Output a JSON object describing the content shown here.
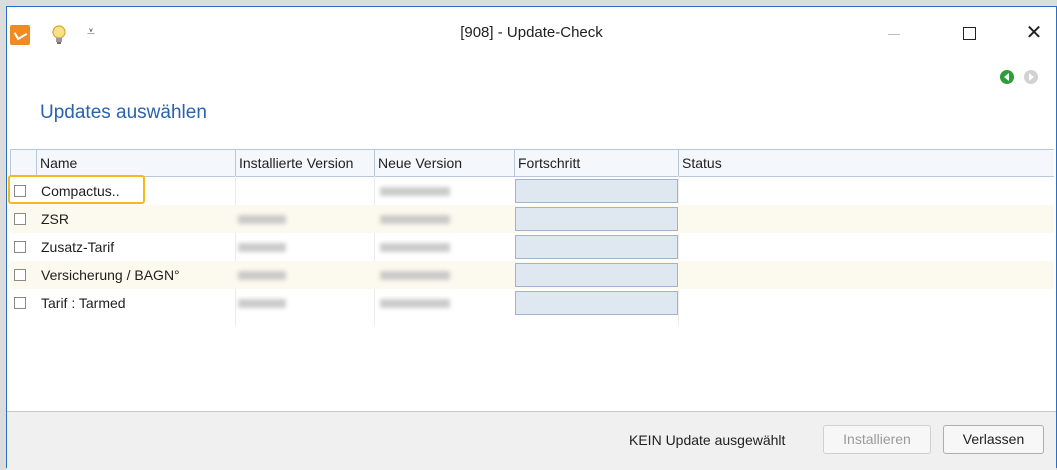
{
  "window": {
    "title": "[908] - Update-Check",
    "quick_access": "⩡",
    "close_glyph": "✕"
  },
  "heading": "Updates auswählen",
  "columns": [
    "Name",
    "Installierte Version",
    "Neue Version",
    "Fortschritt",
    "Status"
  ],
  "rows": [
    {
      "name": "Compactus..",
      "installed_blurred": false,
      "new_blurred": true,
      "checked": false,
      "highlighted": true
    },
    {
      "name": "ZSR",
      "installed_blurred": true,
      "new_blurred": true,
      "checked": false
    },
    {
      "name": "Zusatz-Tarif",
      "installed_blurred": true,
      "new_blurred": true,
      "checked": false
    },
    {
      "name": "Versicherung / BAGN°",
      "installed_blurred": true,
      "new_blurred": true,
      "checked": false
    },
    {
      "name": "Tarif : Tarmed",
      "installed_blurred": true,
      "new_blurred": true,
      "checked": false
    }
  ],
  "footer": {
    "status": "KEIN Update ausgewählt",
    "install_label": "Installieren",
    "leave_label": "Verlassen"
  },
  "colors": {
    "accent_blue": "#2a62ad",
    "highlight": "#f6b81b",
    "app_orange": "#f08a24",
    "nav_green": "#2e9e3a"
  },
  "icons": {
    "app": "app-logo-icon",
    "bulb": "lightbulb-icon",
    "back": "back-arrow-icon",
    "forward": "forward-arrow-icon"
  }
}
